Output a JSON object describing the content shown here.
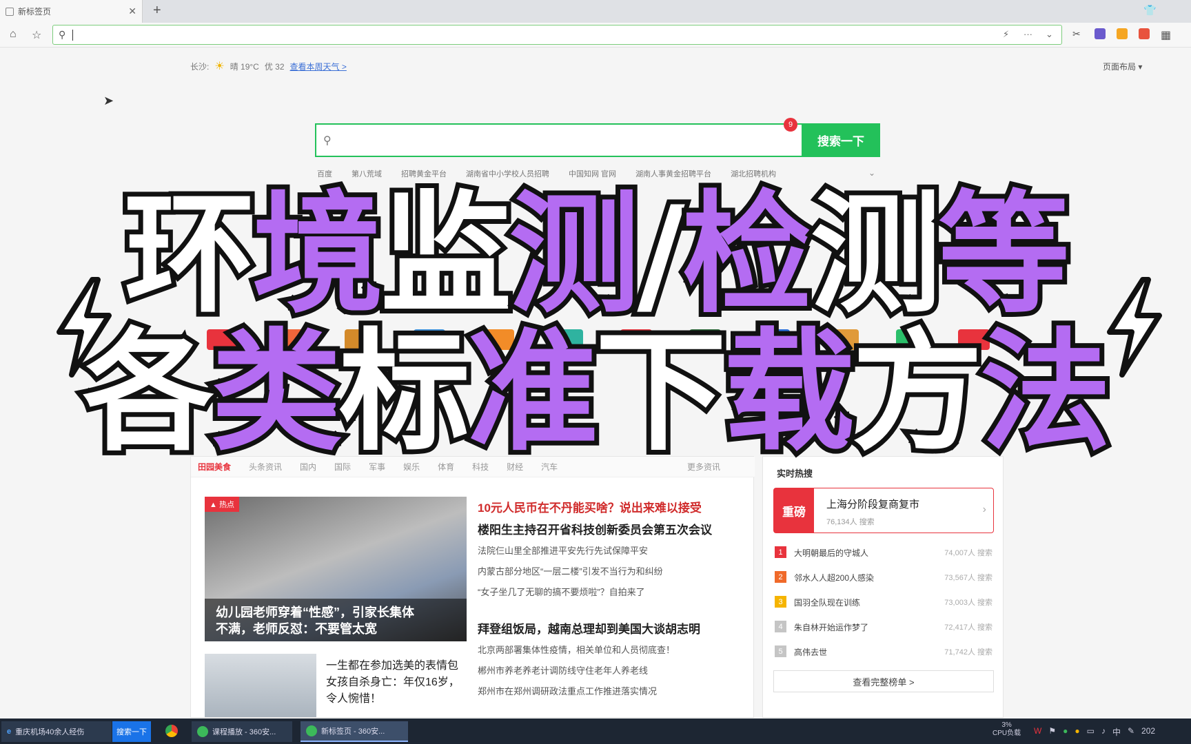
{
  "browser": {
    "tab_title": "新标签页",
    "address_value": "",
    "toolbar_more": "···"
  },
  "page": {
    "weather": {
      "city": "长沙:",
      "condition": "晴 19°C",
      "aqi": "优 32",
      "link": "查看本周天气 >"
    },
    "layout_button": "页面布局 ▾",
    "search": {
      "button_label": "搜索一下",
      "badge": "9"
    },
    "quick_links": [
      "百度",
      "第八荒域",
      "招聘黄金平台",
      "湖南省中小学校人员招聘",
      "中国知网 官网",
      "湖南人事黄金招聘平台",
      "湖北招聘机构"
    ],
    "news": {
      "section_title": "田园美食",
      "tabs": [
        "头条资讯",
        "国内",
        "国际",
        "军事",
        "娱乐",
        "体育",
        "科技",
        "财经",
        "汽车"
      ],
      "more": "更多资讯",
      "hot_tag": "热点",
      "hot_caption_1": "幼儿园老师穿着“性感”，引家长集体",
      "hot_caption_2": "不满，老师反怼：不要管太宽",
      "thumb_text": "一生都在参加选美的表情包女孩自杀身亡：年仅16岁，令人惋惜！",
      "headlines": [
        "10元人民币在不丹能买啥？说出来难以接受",
        "楼阳生主持召开省科技创新委员会第五次会议",
        "拜登组饭局，越南总理却到美国大谈胡志明"
      ],
      "sublines_1": [
        "法院仨山里全部推进平安先行先试保障平安",
        "内蒙古部分地区“一层二楼”引发不当行为和纠纷",
        "“女子坐几了无聊的搞不要烦啦”？自拍来了"
      ],
      "sublines_2": [
        "北京两部署集体性疫情，相关单位和人员彻底查！",
        "郴州市养老养老计调防线守住老年人养老线",
        "郑州市在郑州调研政法重点工作推进落实情况"
      ]
    },
    "ranking": {
      "title": "实时热搜",
      "card_badge": "重磅",
      "card_title": "上海分阶段复商复市",
      "card_count": "76,134人 搜索",
      "items": [
        {
          "num": "1",
          "name": "大明朝最后的守城人",
          "count": "74,007人 搜索"
        },
        {
          "num": "2",
          "name": "邻水人人超200人感染",
          "count": "73,567人 搜索"
        },
        {
          "num": "3",
          "name": "国羽全队现在训练",
          "count": "73,003人 搜索"
        },
        {
          "num": "4",
          "name": "朱自林开始运作梦了",
          "count": "72,417人 搜索"
        },
        {
          "num": "5",
          "name": "高伟去世",
          "count": "71,742人 搜索"
        }
      ],
      "more": "查看完整榜单 >"
    }
  },
  "overlay": {
    "line1": [
      {
        "text": "环",
        "color": "white"
      },
      {
        "text": "境",
        "color": "purple"
      },
      {
        "text": "监",
        "color": "white"
      },
      {
        "text": "测",
        "color": "purple"
      },
      {
        "text": "/",
        "color": "white"
      },
      {
        "text": "检",
        "color": "purple"
      },
      {
        "text": "测",
        "color": "white"
      },
      {
        "text": "等",
        "color": "purple"
      }
    ],
    "line2": [
      {
        "text": "各",
        "color": "white"
      },
      {
        "text": "类",
        "color": "purple"
      },
      {
        "text": "标",
        "color": "white"
      },
      {
        "text": "准",
        "color": "purple"
      },
      {
        "text": "下",
        "color": "white"
      },
      {
        "text": "载",
        "color": "purple"
      },
      {
        "text": "方",
        "color": "white"
      },
      {
        "text": "法",
        "color": "purple"
      }
    ],
    "colors": {
      "purple": "#b46cf2",
      "white": "#ffffff",
      "outline": "#111111"
    }
  },
  "taskbar": {
    "search_text": "重庆机场40余人经伤",
    "search_button": "搜索一下",
    "items": [
      "课程播放 - 360安...",
      "新标签页 - 360安..."
    ],
    "cpu_label": "3%",
    "cpu_text": "CPU负载",
    "ime": "中",
    "date": "202"
  },
  "icons": [
    "home-icon",
    "star-icon",
    "search-icon",
    "lightning-icon",
    "chevron-down-icon",
    "scissors-icon",
    "grid-icon",
    "shirt-icon",
    "cursor-icon",
    "fire-icon"
  ]
}
